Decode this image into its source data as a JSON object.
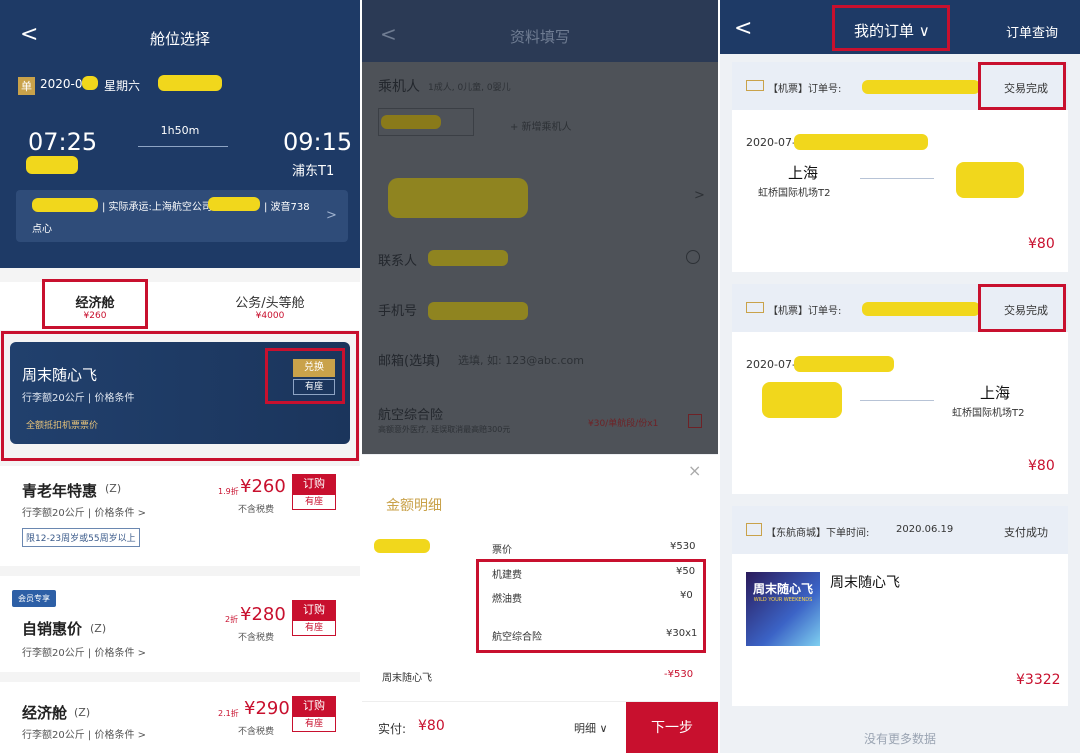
{
  "panel1": {
    "title": "舱位选择",
    "back": "<",
    "badge": "单",
    "date_prefix": "2020-07",
    "weekday": "星期六",
    "depart_time": "07:25",
    "duration": "1h50m",
    "arrive_time": "09:15",
    "arrive_airport": "浦东T1",
    "carrier_text": "| 实际承运:上海航空公司",
    "aircraft": "| 波音738",
    "snack": "点心",
    "chevron": ">",
    "tab_economy": "经济舱",
    "tab_economy_price": "¥260",
    "tab_business": "公务/头等舱",
    "tab_business_price": "¥4000",
    "promo_title": "周末随心飞",
    "promo_sub": "行李额20公斤 | 价格条件",
    "promo_note": "全额抵扣机票票价",
    "promo_btn": "兑换",
    "promo_seat": "有座",
    "fares": [
      {
        "name": "青老年特惠",
        "code": "(Z)",
        "discount": "1.9折",
        "price": "¥260",
        "tax": "不含税费",
        "sub": "行李额20公斤 | 价格条件 >",
        "tag": "限12-23周岁或55周岁以上",
        "book": "订购",
        "seat": "有座"
      },
      {
        "name": "自销惠价",
        "code": "(Z)",
        "discount": "2折",
        "price": "¥280",
        "tax": "不含税费",
        "sub": "行李额20公斤 | 价格条件 >",
        "member": "会员专享",
        "book": "订购",
        "seat": "有座"
      },
      {
        "name": "经济舱",
        "code": "(Z)",
        "discount": "2.1折",
        "price": "¥290",
        "tax": "不含税费",
        "sub": "行李额20公斤 | 价格条件 >",
        "book": "订购",
        "seat": "有座"
      }
    ]
  },
  "panel2": {
    "title": "资料填写",
    "passenger_label": "乘机人",
    "passenger_counts": "1成人, 0儿童, 0婴儿",
    "add_passenger": "+ 新增乘机人",
    "contact_label": "联系人",
    "phone_label": "手机号",
    "email_label": "邮箱(选填)",
    "email_placeholder": "选填, 如: 123@abc.com",
    "insurance_label": "航空综合险",
    "insurance_desc": "高额意外医疗, 延误取消最高赔300元",
    "insurance_price": "¥30/单航段/份x1",
    "sheet_title": "金额明细",
    "close": "×",
    "ticket_label": "票价",
    "ticket_value": "¥530",
    "items": [
      {
        "label": "机建费",
        "value": "¥50"
      },
      {
        "label": "燃油费",
        "value": "¥0"
      },
      {
        "label": "航空综合险",
        "value": "¥30x1"
      }
    ],
    "discount_label": "周末随心飞",
    "discount_value": "-¥530",
    "pay_label": "实付:",
    "pay_value": "¥80",
    "detail_link": "明细 ∨",
    "next_btn": "下一步"
  },
  "panel3": {
    "title": "我的订单 ∨",
    "query": "订单查询",
    "orders": [
      {
        "type": "【机票】订单号:",
        "status": "交易完成",
        "date": "2020-07-",
        "from_city": "上海",
        "from_airport": "虹桥国际机场T2",
        "price": "¥80"
      },
      {
        "type": "【机票】订单号:",
        "status": "交易完成",
        "date": "2020-07-",
        "to_city": "上海",
        "to_airport": "虹桥国际机场T2",
        "price": "¥80"
      }
    ],
    "shop_type": "【东航商城】下单时间:",
    "shop_time": "2020.06.19",
    "shop_status": "支付成功",
    "shop_product": "周末随心飞",
    "shop_img_title": "周末随心飞",
    "shop_img_sub": "WILD YOUR WEEKENDS",
    "shop_price": "¥3322",
    "no_more": "没有更多数据"
  },
  "colors": {
    "navy": "#1e3a66",
    "red": "#c8102e",
    "gold": "#c9a24a"
  }
}
